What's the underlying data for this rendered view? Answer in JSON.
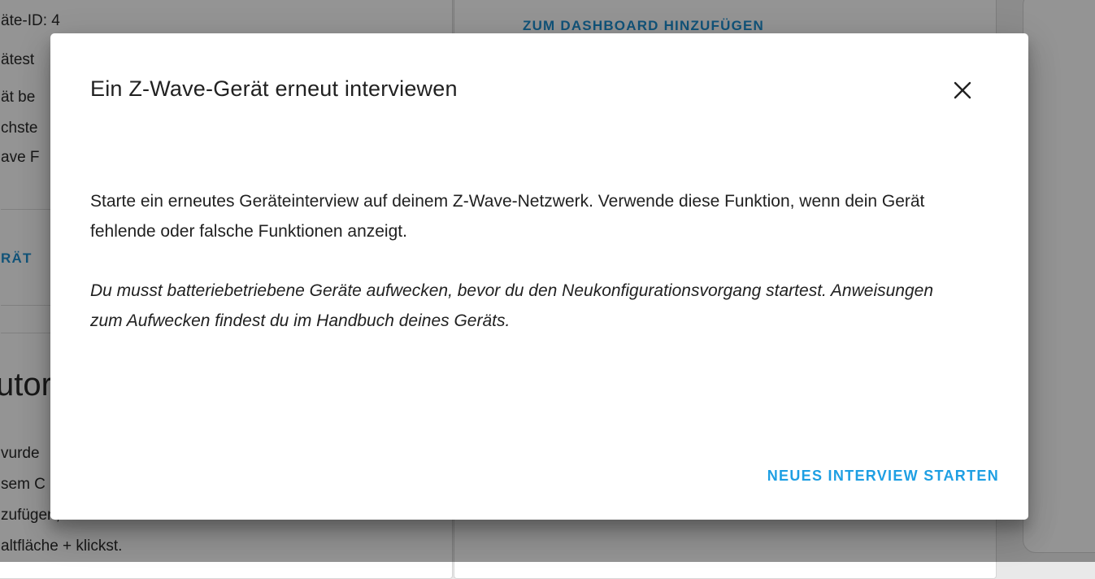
{
  "background": {
    "left_card": {
      "info_lines": [
        "äte-ID: 4",
        "ätest",
        "ät be",
        "chste",
        "ave F"
      ],
      "action_link": "RÄT",
      "automations_heading": "utor",
      "automations_lines": [
        "vurde",
        "sem C",
        "zufügen, indem du oben auf die",
        "altfläche + klickst."
      ]
    },
    "mid_card": {
      "add_to_dashboard": "ZUM DASHBOARD HINZUFÜGEN"
    }
  },
  "dialog": {
    "title": "Ein Z-Wave-Gerät erneut interviewen",
    "close_icon": "close-icon",
    "description": "Starte ein erneutes Geräteinterview auf deinem Z-Wave-Netzwerk. Verwende diese Funktion, wenn dein Gerät fehlende oder falsche Funktionen anzeigt.",
    "note": "Du musst batteriebetriebene Geräte aufwecken, bevor du den Neukonfigurationsvorgang startest. Anweisungen zum Aufwecken findest du im Handbuch deines Geräts.",
    "primary_action": "NEUES INTERVIEW STARTEN"
  },
  "colors": {
    "accent": "#1e9fe3",
    "scrim": "rgba(0,0,0,0.42)"
  }
}
